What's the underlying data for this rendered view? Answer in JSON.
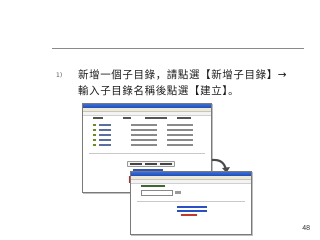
{
  "instruction": {
    "number": "1)",
    "line1": "新增一個子目錄，請點選【新增子目錄】→",
    "line2": "輸入子目錄名稱後點選【建立】。"
  },
  "page_number": "48",
  "colors": {
    "rule": "#8a8a8a",
    "title_bar": "#2a5ac4",
    "highlight": "#d32020",
    "arrow": "#4a4a4a"
  },
  "icons": [
    "curved-arrow-icon"
  ]
}
